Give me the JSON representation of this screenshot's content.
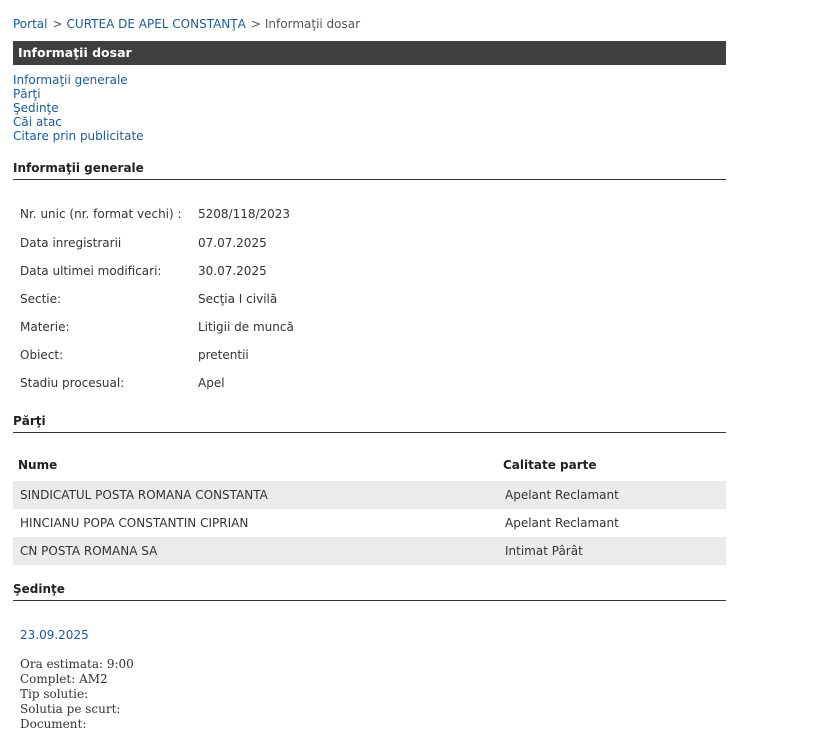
{
  "breadcrumb": {
    "items": [
      "Portal",
      "CURTEA DE APEL CONSTANŢA"
    ],
    "separator": ">",
    "current": "Informaţii dosar"
  },
  "title_bar": {
    "title": "Informaţii dosar"
  },
  "anchors": [
    "Informaţii generale",
    "Părţi",
    "Şedinţe",
    "Căi atac",
    "Citare prin publicitate"
  ],
  "general": {
    "heading": "Informaţii generale",
    "rows": [
      {
        "label": "Nr. unic (nr. format vechi) :",
        "value": "5208/118/2023"
      },
      {
        "label": "Data inregistrarii",
        "value": "07.07.2025"
      },
      {
        "label": "Data ultimei modificari:",
        "value": "30.07.2025"
      },
      {
        "label": "Sectie:",
        "value": "Secţia I civilă"
      },
      {
        "label": "Materie:",
        "value": "Litigii de muncă"
      },
      {
        "label": "Obiect:",
        "value": "pretentii"
      },
      {
        "label": "Stadiu procesual:",
        "value": "Apel"
      }
    ]
  },
  "parti": {
    "heading": "Părţi",
    "columns": [
      "Nume",
      "Calitate parte"
    ],
    "rows": [
      {
        "nume": "SINDICATUL POSTA ROMANA CONSTANTA",
        "calitate": "Apelant Reclamant"
      },
      {
        "nume": "HINCIANU POPA CONSTANTIN CIPRIAN",
        "calitate": "Apelant Reclamant"
      },
      {
        "nume": "CN POSTA ROMANA SA",
        "calitate": "Intimat Pârât"
      }
    ]
  },
  "sedinte": {
    "heading": "Şedinţe",
    "date": "23.09.2025",
    "details": [
      "Ora estimata: 9:00",
      "Complet: AM2",
      "Tip solutie:",
      "Solutia pe scurt:",
      "Document:"
    ]
  },
  "colors": {
    "link": "#1a5c99",
    "title_bar": "#3f3f3f",
    "row_shade": "#ebebeb"
  }
}
